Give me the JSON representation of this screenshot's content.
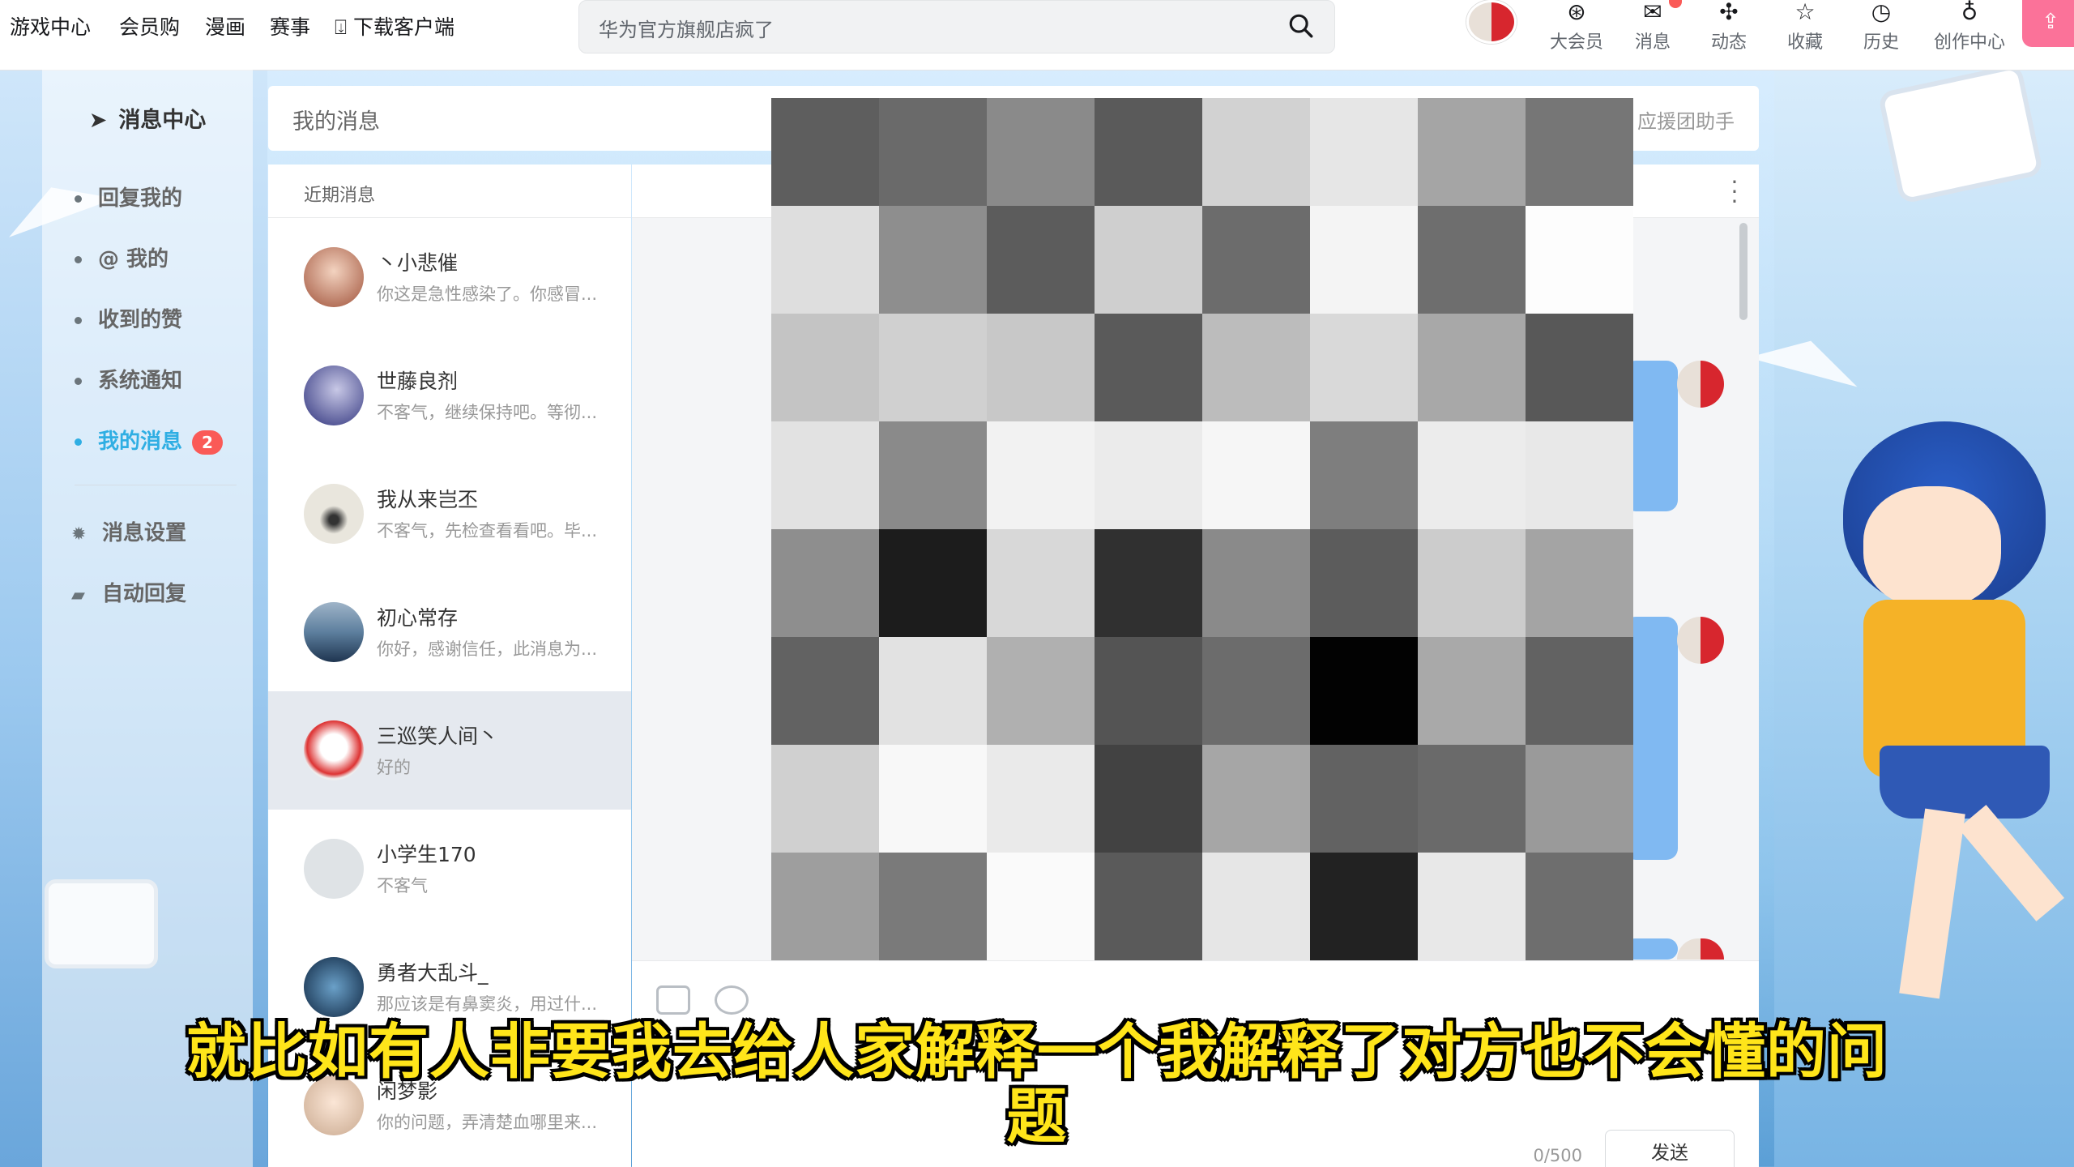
{
  "topbar": {
    "links": [
      "游戏中心",
      "会员购",
      "漫画",
      "赛事",
      "下载客户端"
    ],
    "search_placeholder": "华为官方旗舰店疯了",
    "right_items": [
      {
        "label": "大会员",
        "icon": "vip-icon"
      },
      {
        "label": "消息",
        "icon": "message-icon"
      },
      {
        "label": "动态",
        "icon": "dynamic-icon"
      },
      {
        "label": "收藏",
        "icon": "star-icon"
      },
      {
        "label": "历史",
        "icon": "clock-icon"
      },
      {
        "label": "创作中心",
        "icon": "bulb-icon"
      }
    ]
  },
  "sidebar": {
    "title": "消息中心",
    "items": [
      {
        "label": "回复我的"
      },
      {
        "label": "@ 我的"
      },
      {
        "label": "收到的赞"
      },
      {
        "label": "系统通知"
      },
      {
        "label": "我的消息",
        "badge": "2"
      }
    ],
    "settings": [
      {
        "label": "消息设置",
        "icon": "gear-icon"
      },
      {
        "label": "自动回复",
        "icon": "chat-bubble-icon"
      }
    ]
  },
  "header": {
    "title": "我的消息",
    "right": "应援团助手"
  },
  "conversations": {
    "heading": "近期消息",
    "items": [
      {
        "name": "丶小悲催",
        "preview": "你这是急性感染了。你感冒..."
      },
      {
        "name": "世藤良剂",
        "preview": "不客气，继续保持吧。等彻..."
      },
      {
        "name": "我从来岂丕",
        "preview": "不客气，先检查看看吧。毕..."
      },
      {
        "name": "初心常存",
        "preview": "你好，感谢信任，此消息为..."
      },
      {
        "name": "三巡笑人间丶",
        "preview": "好的"
      },
      {
        "name": "小学生170",
        "preview": "不客气"
      },
      {
        "name": "勇者大乱斗_",
        "preview": "那应该是有鼻窦炎，用过什..."
      },
      {
        "name": "闲梦影",
        "preview": "你的问题，弄清楚血哪里来..."
      }
    ]
  },
  "composer": {
    "counter": "0/500",
    "send_label": "发送"
  },
  "subtitle": {
    "line1": "就比如有人非要我去给人家解释一个我解释了对方也不会懂的问",
    "line2": "题"
  },
  "colors": {
    "accent": "#2faee3",
    "badge": "#fa5a57",
    "subtitle": "#ffe51a",
    "bubble": "#80b9f2"
  }
}
